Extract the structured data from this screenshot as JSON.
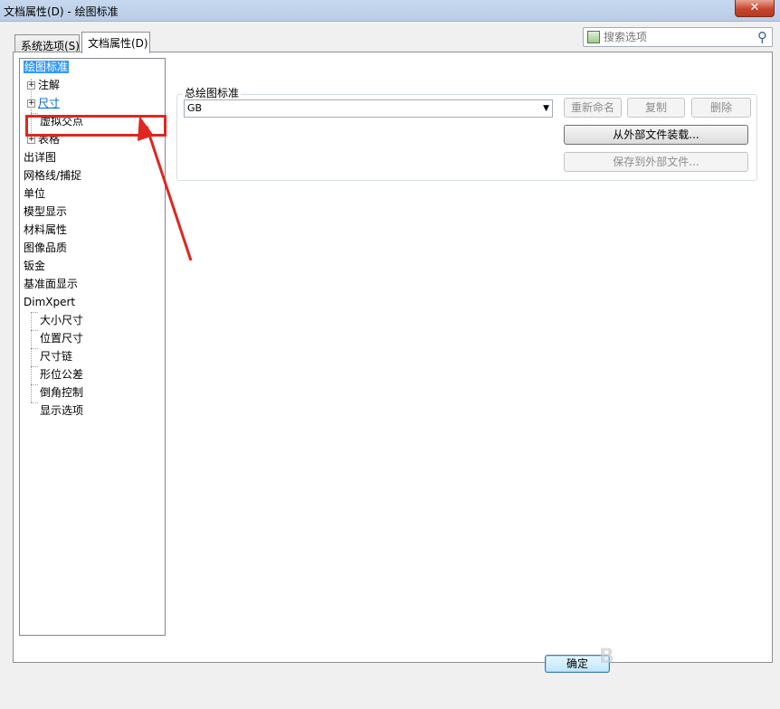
{
  "window": {
    "title": "文档属性(D) - 绘图标准",
    "close_label": "✕"
  },
  "tabs": [
    {
      "label": "系统选项(S)",
      "active": false
    },
    {
      "label": "文档属性(D)",
      "active": true
    }
  ],
  "search": {
    "placeholder": "搜索选项",
    "icon": "search-icon"
  },
  "tree": {
    "items": [
      {
        "label": "绘图标准",
        "selected": true
      },
      {
        "label": "注解",
        "expander": "+"
      },
      {
        "label": "尺寸",
        "expander": "+",
        "highlighted": true
      },
      {
        "label": "虚拟交点"
      },
      {
        "label": "表格",
        "expander": "+"
      },
      {
        "label": "出详图"
      },
      {
        "label": "网格线/捕捉"
      },
      {
        "label": "单位"
      },
      {
        "label": "模型显示"
      },
      {
        "label": "材料属性"
      },
      {
        "label": "图像品质"
      },
      {
        "label": "钣金"
      },
      {
        "label": "基准面显示"
      },
      {
        "label": "DimXpert"
      },
      {
        "label": "大小尺寸"
      },
      {
        "label": "位置尺寸"
      },
      {
        "label": "尺寸链"
      },
      {
        "label": "形位公差"
      },
      {
        "label": "倒角控制"
      },
      {
        "label": "显示选项"
      }
    ]
  },
  "drafting_standard": {
    "group_label": "总绘图标准",
    "selected_value": "GB",
    "rename_button": "重新命名",
    "copy_button": "复制",
    "delete_button": "删除",
    "load_button": "从外部文件装载...",
    "save_button": "保存到外部文件..."
  },
  "footer": {
    "ok_button": "确定"
  },
  "colors": {
    "highlight": "#e0261f",
    "selection": "#3399ff",
    "link": "#0066cc"
  }
}
